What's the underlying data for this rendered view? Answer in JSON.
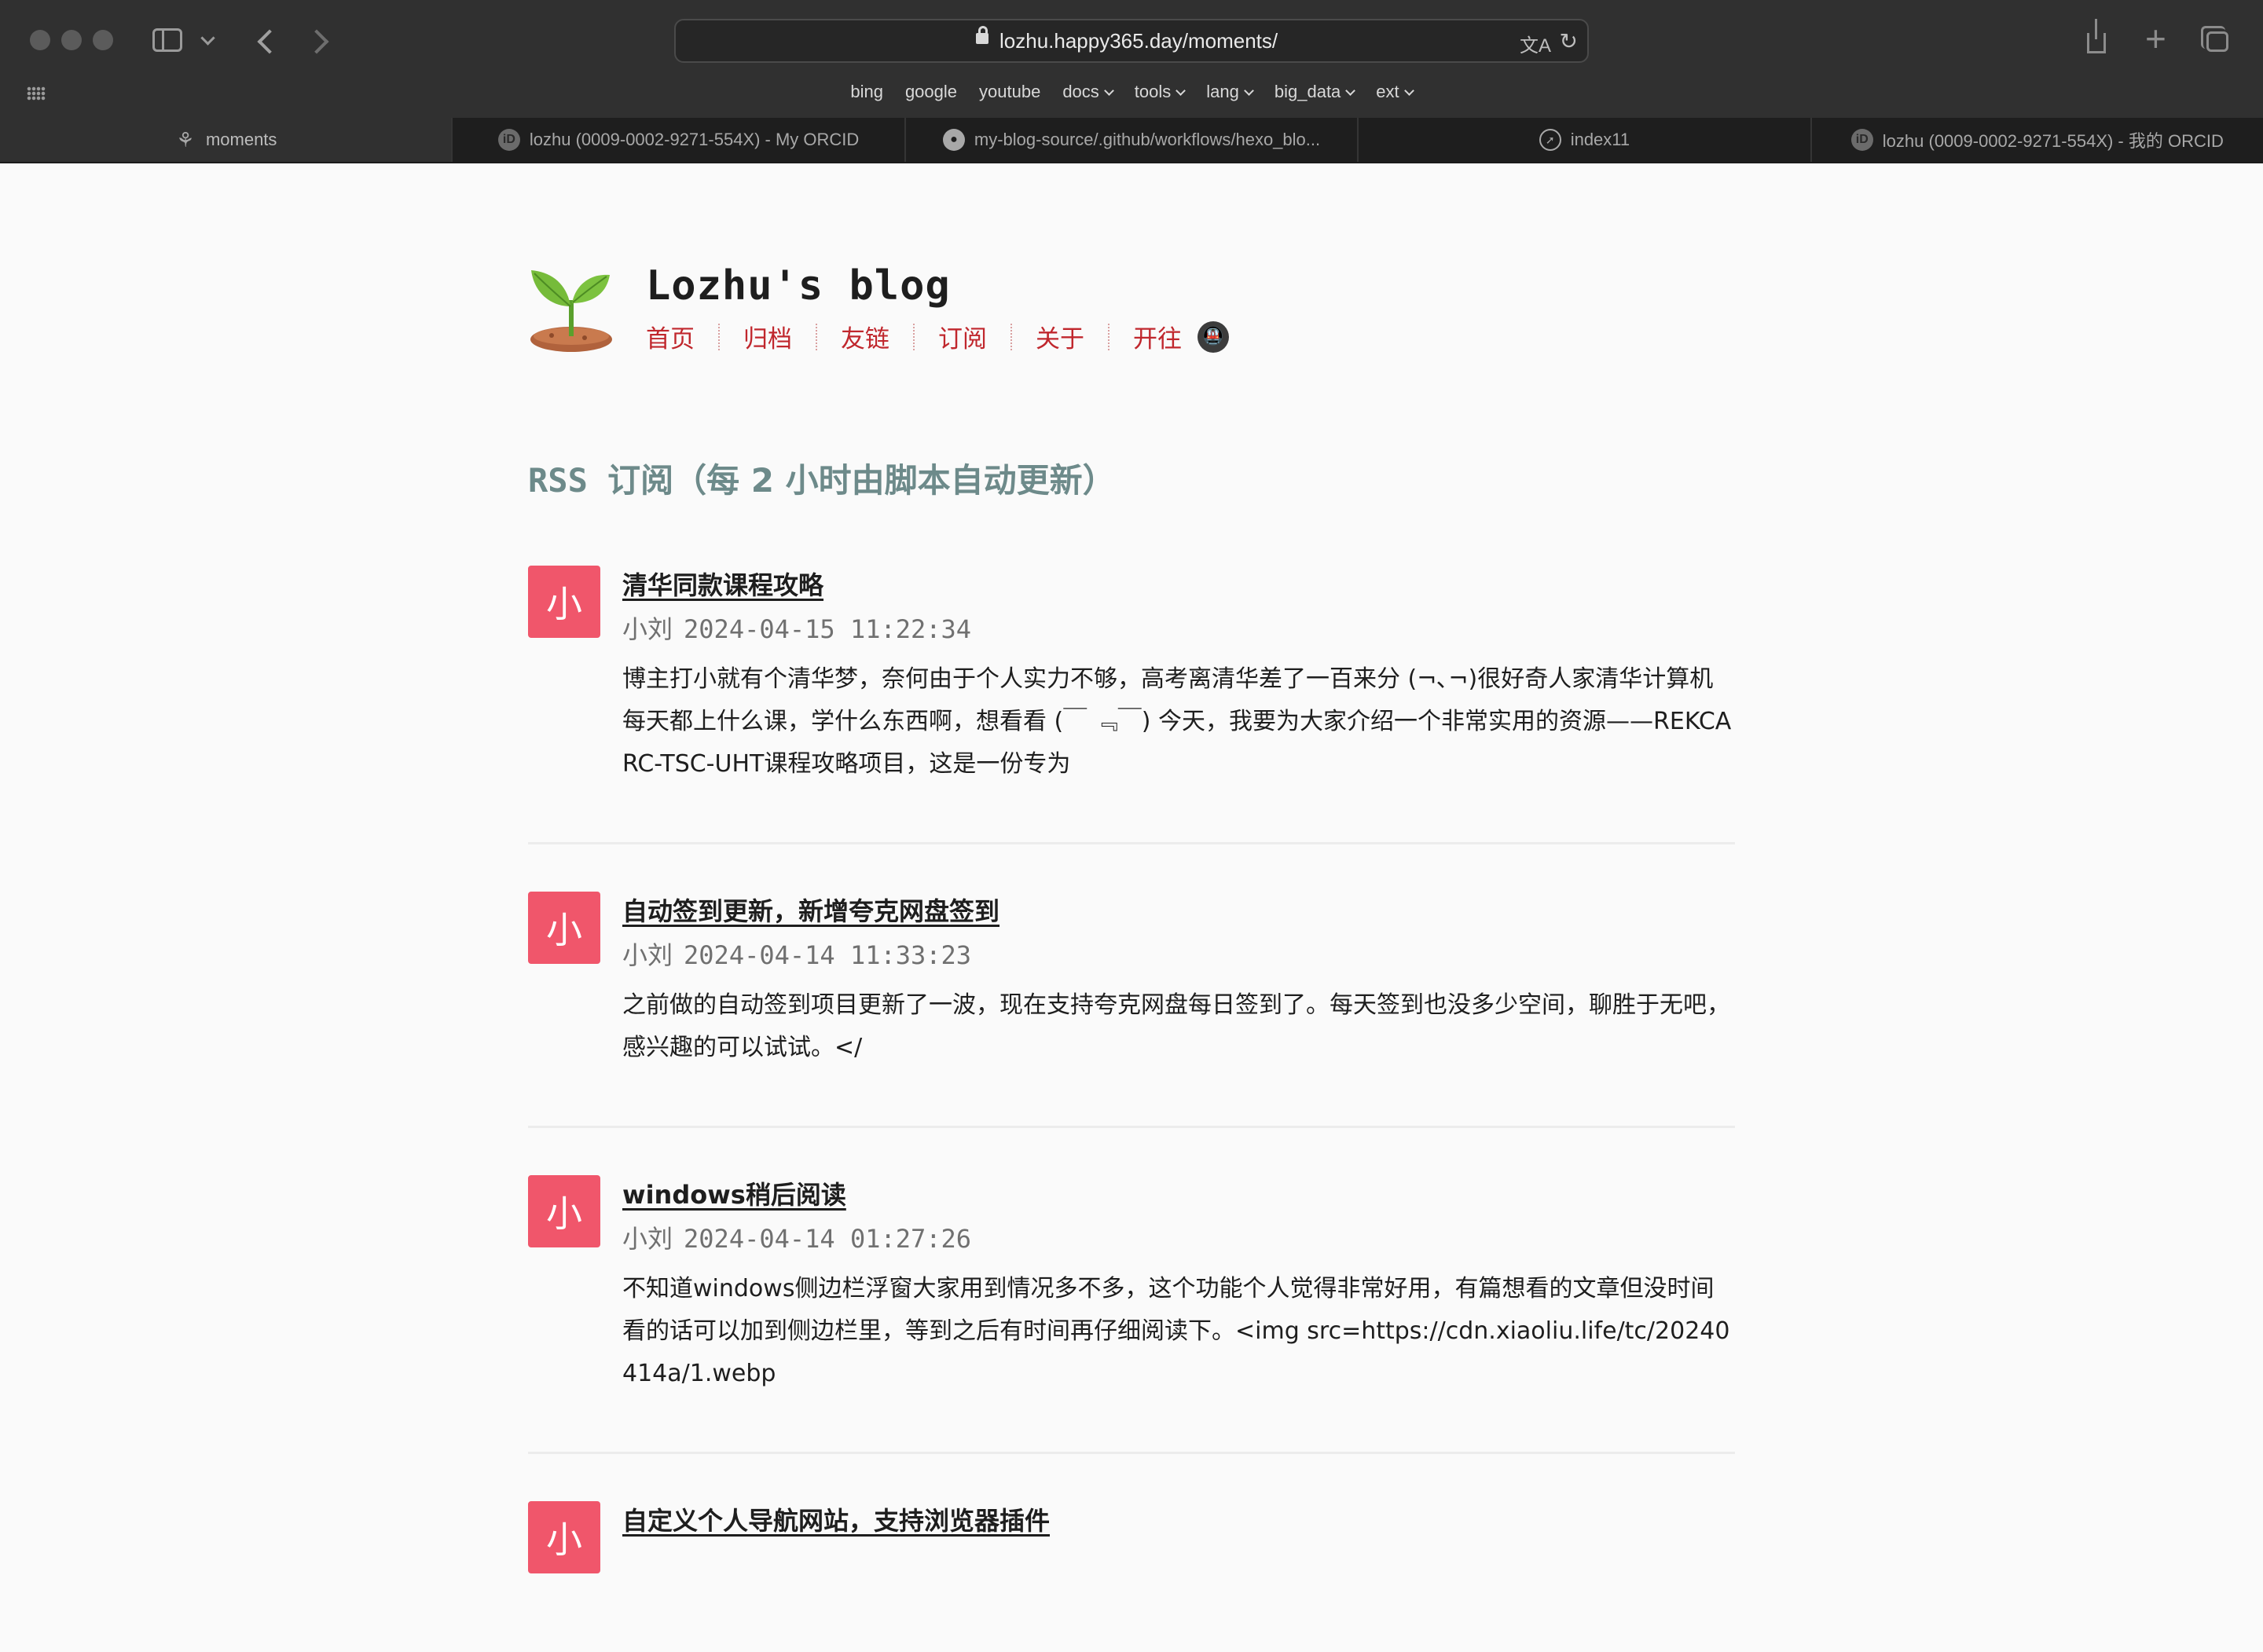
{
  "browser": {
    "url": "lozhu.happy365.day/moments/",
    "bookmarks": [
      {
        "label": "bing",
        "dropdown": false
      },
      {
        "label": "google",
        "dropdown": false
      },
      {
        "label": "youtube",
        "dropdown": false
      },
      {
        "label": "docs",
        "dropdown": true
      },
      {
        "label": "tools",
        "dropdown": true
      },
      {
        "label": "lang",
        "dropdown": true
      },
      {
        "label": "big_data",
        "dropdown": true
      },
      {
        "label": "ext",
        "dropdown": true
      }
    ],
    "tabs": [
      {
        "label": "moments",
        "icon": "sprout-icon",
        "active": true
      },
      {
        "label": "lozhu (0009-0002-9271-554X) - My ORCID",
        "icon": "orcid-icon",
        "active": false
      },
      {
        "label": "my-blog-source/.github/workflows/hexo_blo...",
        "icon": "github-icon",
        "active": false
      },
      {
        "label": "index11",
        "icon": "compass-icon",
        "active": false
      },
      {
        "label": "lozhu (0009-0002-9271-554X) - 我的 ORCID",
        "icon": "orcid-icon",
        "active": false
      }
    ]
  },
  "site": {
    "title": "Lozhu's blog",
    "menu": [
      "首页",
      "归档",
      "友链",
      "订阅",
      "关于",
      "开往"
    ],
    "accent_color": "#c0272d"
  },
  "section": {
    "title_prefix": "RSS",
    "title_rest": "订阅（每 2 小时由脚本自动更新）"
  },
  "posts": [
    {
      "avatar": "小",
      "title": "清华同款课程攻略",
      "author": "小刘",
      "date": "2024-04-15 11:22:34",
      "body": "博主打小就有个清华梦，奈何由于个人实力不够，高考离清华差了一百来分 (¬､¬)很好奇人家清华计算机每天都上什么课，学什么东西啊，想看看 (￣ ﹃￣) 今天，我要为大家介绍一个非常实用的资源——REKCARC-TSC-UHT课程攻略项目，这是一份专为"
    },
    {
      "avatar": "小",
      "title": "自动签到更新，新增夸克网盘签到",
      "author": "小刘",
      "date": "2024-04-14 11:33:23",
      "body": "之前做的自动签到项目更新了一波，现在支持夸克网盘每日签到了。每天签到也没多少空间，聊胜于无吧，感兴趣的可以试试。</"
    },
    {
      "avatar": "小",
      "title": "windows稍后阅读",
      "author": "小刘",
      "date": "2024-04-14 01:27:26",
      "body": "不知道windows侧边栏浮窗大家用到情况多不多，这个功能个人觉得非常好用，有篇想看的文章但没时间看的话可以加到侧边栏里，等到之后有时间再仔细阅读下。<img src=https://cdn.xiaoliu.life/tc/20240414a/1.webp"
    },
    {
      "avatar": "小",
      "title": "自定义个人导航网站，支持浏览器插件",
      "author": "",
      "date": "",
      "body": ""
    }
  ]
}
